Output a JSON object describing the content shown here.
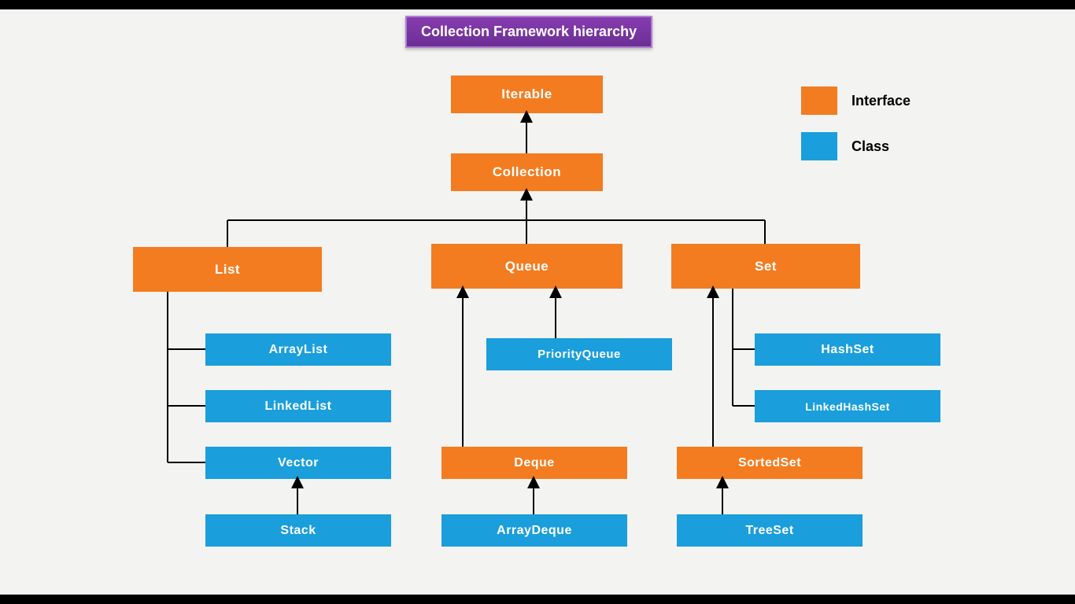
{
  "title": "Collection Framework hierarchy",
  "legend": {
    "interface": "Interface",
    "class": "Class"
  },
  "nodes": {
    "iterable": "Iterable",
    "collection": "Collection",
    "list": "List",
    "queue": "Queue",
    "set": "Set",
    "arraylist": "ArrayList",
    "linkedlist": "LinkedList",
    "vector": "Vector",
    "stack": "Stack",
    "priorityqueue": "PriorityQueue",
    "deque": "Deque",
    "arraydeque": "ArrayDeque",
    "hashset": "HashSet",
    "linkedhashset": "LinkedHashSet",
    "sortedset": "SortedSet",
    "treeset": "TreeSet"
  },
  "colors": {
    "interface": "#f47c20",
    "class": "#1a9edc"
  }
}
